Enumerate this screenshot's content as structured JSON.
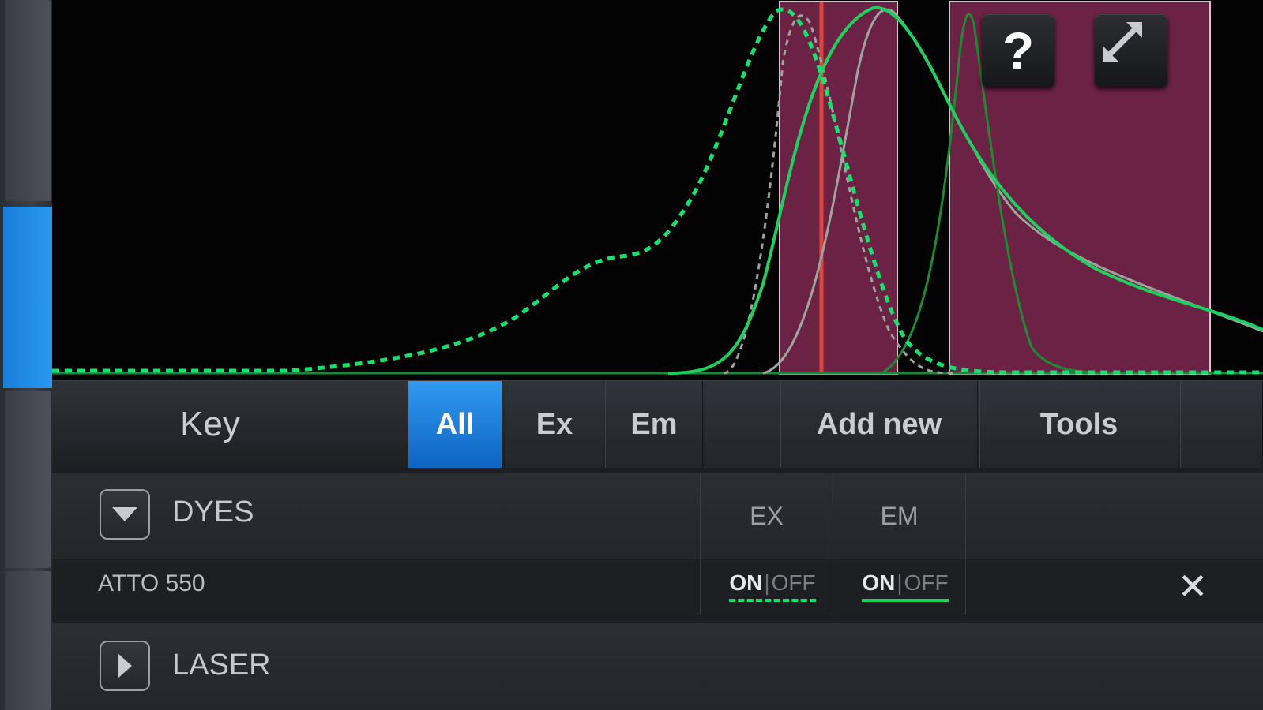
{
  "chart": {
    "colors": {
      "excitation": "#18e070",
      "emission": "#1fcf5f",
      "filter_band": "#6b2244",
      "filter_border": "#d9c2cf",
      "laser_line": "#e0453a",
      "gray_curve": "#9da49f",
      "dark_curve": "#1f8a32"
    }
  },
  "buttons": {
    "help_icon": "question-mark",
    "help_glyph": "?",
    "expand_icon": "diagonal-arrows"
  },
  "tabbar": {
    "key_label": "Key",
    "tabs": [
      "All",
      "Ex",
      "Em"
    ],
    "active_tab": "All",
    "add_new_label": "Add new",
    "tools_label": "Tools",
    "accent": "#1f84e0"
  },
  "dyes": {
    "title": "DYES",
    "col_ex": "EX",
    "col_em": "EM",
    "rows": [
      {
        "name": "ATTO 550",
        "ex_on": "ON",
        "ex_sep": "|",
        "ex_off": "OFF",
        "em_on": "ON",
        "em_sep": "|",
        "em_off": "OFF"
      }
    ],
    "remove_glyph": "✕"
  },
  "laser": {
    "title": "LASER"
  }
}
